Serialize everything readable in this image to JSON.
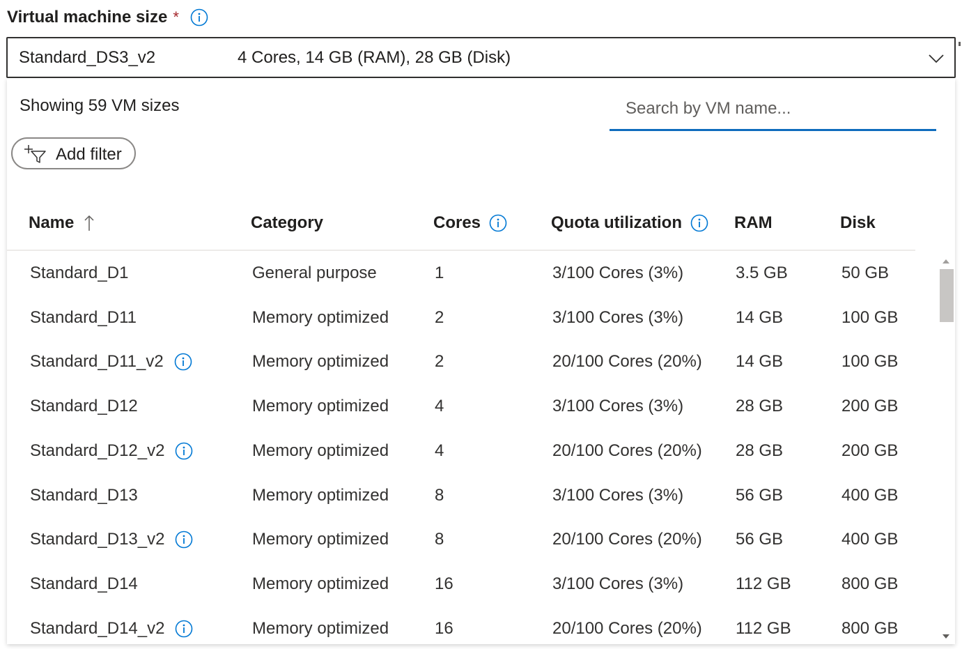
{
  "field": {
    "label": "Virtual machine size",
    "required_mark": "*"
  },
  "dropdown": {
    "selected_name": "Standard_DS3_v2",
    "selected_spec": "4 Cores, 14 GB (RAM), 28 GB (Disk)"
  },
  "panel": {
    "showing_text": "Showing 59 VM sizes",
    "search_placeholder": "Search by VM name...",
    "add_filter_label": "Add filter"
  },
  "table": {
    "columns": {
      "name": "Name",
      "category": "Category",
      "cores": "Cores",
      "quota": "Quota utilization",
      "ram": "RAM",
      "disk": "Disk"
    },
    "sort": {
      "column": "name",
      "direction": "ascending"
    },
    "rows": [
      {
        "name": "Standard_D1",
        "has_info": false,
        "category": "General purpose",
        "cores": "1",
        "quota": "3/100 Cores (3%)",
        "ram": "3.5 GB",
        "disk": "50 GB"
      },
      {
        "name": "Standard_D11",
        "has_info": false,
        "category": "Memory optimized",
        "cores": "2",
        "quota": "3/100 Cores (3%)",
        "ram": "14 GB",
        "disk": "100 GB"
      },
      {
        "name": "Standard_D11_v2",
        "has_info": true,
        "category": "Memory optimized",
        "cores": "2",
        "quota": "20/100 Cores (20%)",
        "ram": "14 GB",
        "disk": "100 GB"
      },
      {
        "name": "Standard_D12",
        "has_info": false,
        "category": "Memory optimized",
        "cores": "4",
        "quota": "3/100 Cores (3%)",
        "ram": "28 GB",
        "disk": "200 GB"
      },
      {
        "name": "Standard_D12_v2",
        "has_info": true,
        "category": "Memory optimized",
        "cores": "4",
        "quota": "20/100 Cores (20%)",
        "ram": "28 GB",
        "disk": "200 GB"
      },
      {
        "name": "Standard_D13",
        "has_info": false,
        "category": "Memory optimized",
        "cores": "8",
        "quota": "3/100 Cores (3%)",
        "ram": "56 GB",
        "disk": "400 GB"
      },
      {
        "name": "Standard_D13_v2",
        "has_info": true,
        "category": "Memory optimized",
        "cores": "8",
        "quota": "20/100 Cores (20%)",
        "ram": "56 GB",
        "disk": "400 GB"
      },
      {
        "name": "Standard_D14",
        "has_info": false,
        "category": "Memory optimized",
        "cores": "16",
        "quota": "3/100 Cores (3%)",
        "ram": "112 GB",
        "disk": "800 GB"
      },
      {
        "name": "Standard_D14_v2",
        "has_info": true,
        "category": "Memory optimized",
        "cores": "16",
        "quota": "20/100 Cores (20%)",
        "ram": "112 GB",
        "disk": "800 GB"
      }
    ]
  },
  "icons": {
    "info": "info-circle-icon",
    "chevron": "chevron-down-icon",
    "filter": "add-filter-icon",
    "sort": "sort-ascending-icon"
  },
  "colors": {
    "accent": "#0f6cbd",
    "info_icon": "#0078d4",
    "required": "#a4262c",
    "text": "#323130"
  }
}
